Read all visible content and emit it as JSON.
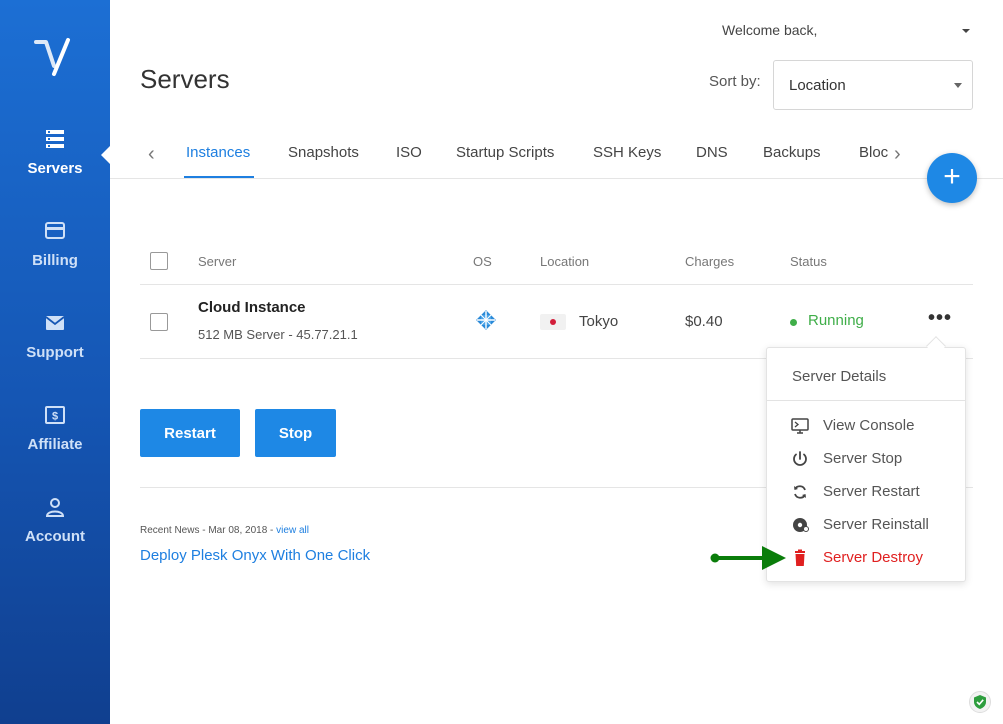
{
  "sidebar": {
    "logo": "vultr-v-logo",
    "items": [
      {
        "label": "Servers",
        "icon": "server-stack-icon",
        "active": true
      },
      {
        "label": "Billing",
        "icon": "credit-card-icon"
      },
      {
        "label": "Support",
        "icon": "envelope-icon"
      },
      {
        "label": "Affiliate",
        "icon": "dollar-bill-icon"
      },
      {
        "label": "Account",
        "icon": "user-icon"
      }
    ]
  },
  "header": {
    "welcome": "Welcome back,",
    "title": "Servers",
    "sort_label": "Sort by:",
    "sort_value": "Location"
  },
  "tabs": [
    "Instances",
    "Snapshots",
    "ISO",
    "Startup Scripts",
    "SSH Keys",
    "DNS",
    "Backups",
    "Bloc"
  ],
  "active_tab": "Instances",
  "table": {
    "columns": [
      "Server",
      "OS",
      "Location",
      "Charges",
      "Status"
    ],
    "rows": [
      {
        "name": "Cloud Instance",
        "subtitle": "512 MB Server - 45.77.21.1",
        "os_icon": "centos-icon",
        "location": "Tokyo",
        "flag": "japan-flag",
        "charges": "$0.40",
        "status": "Running"
      }
    ]
  },
  "buttons": {
    "restart": "Restart",
    "stop": "Stop"
  },
  "news": {
    "meta": "Recent News - Mar 08, 2018 - ",
    "view_all": "view all",
    "title": "Deploy Plesk Onyx With One Click"
  },
  "menu": {
    "header": "Server Details",
    "items": [
      {
        "label": "View Console",
        "icon": "console-icon"
      },
      {
        "label": "Server Stop",
        "icon": "power-icon"
      },
      {
        "label": "Server Restart",
        "icon": "refresh-icon"
      },
      {
        "label": "Server Reinstall",
        "icon": "disc-icon"
      },
      {
        "label": "Server Destroy",
        "icon": "trash-icon",
        "danger": true
      }
    ]
  },
  "colors": {
    "sidebar": "#1c6fd4",
    "accent": "#1e88e5",
    "running": "#3fae49",
    "danger": "#e02020",
    "annotation_arrow": "#0a7d0a"
  }
}
